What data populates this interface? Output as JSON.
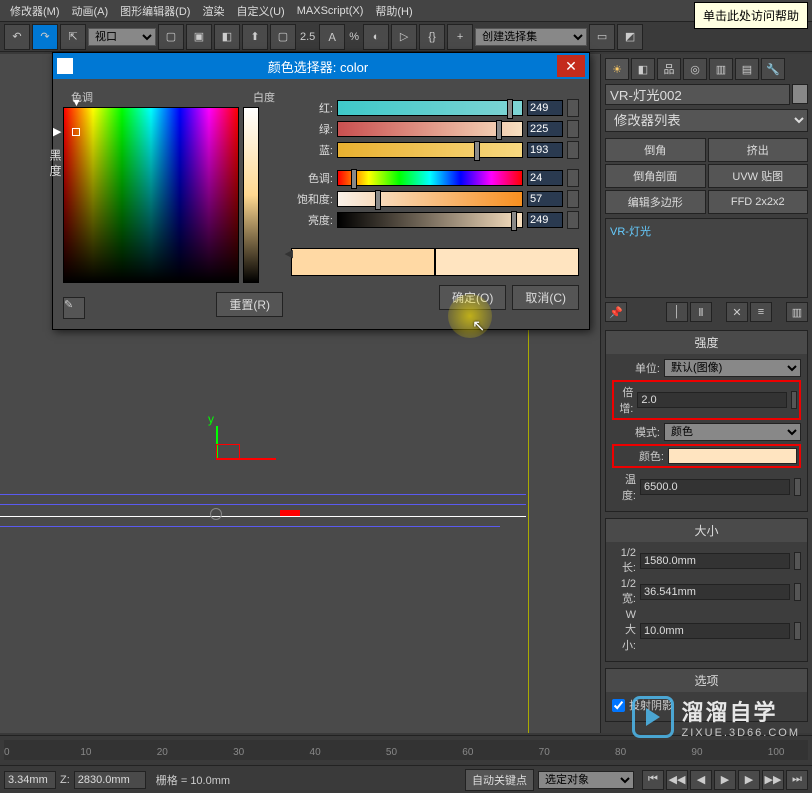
{
  "menubar": {
    "items": [
      "修改器(M)",
      "动画(A)",
      "图形编辑器(D)",
      "渲染",
      "自定义(U)",
      "MAXScript(X)",
      "帮助(H)"
    ]
  },
  "tooltip": "单击此处访问帮助",
  "toolbar": {
    "view_dropdown": "视口",
    "zoom_label": "2.5",
    "percent": "%",
    "selset_dropdown": "创建选择集"
  },
  "dialog": {
    "title": "颜色选择器: color",
    "hue_label": "色调",
    "whiteness_label": "白度",
    "blackness_label": "黑\n度",
    "channels": {
      "red": {
        "label": "红:",
        "value": "249"
      },
      "green": {
        "label": "绿:",
        "value": "225"
      },
      "blue": {
        "label": "蓝:",
        "value": "193"
      },
      "hue": {
        "label": "色调:",
        "value": "24"
      },
      "sat": {
        "label": "饱和度:",
        "value": "57"
      },
      "val": {
        "label": "亮度:",
        "value": "249"
      }
    },
    "swatch_old": "#ffd9a4",
    "swatch_new": "#ffe4c0",
    "reset_btn": "重置(R)",
    "ok_btn": "确定(O)",
    "cancel_btn": "取消(C)"
  },
  "viewport": {
    "axis_y": "y"
  },
  "rightpanel": {
    "object_name": "VR-灯光002",
    "modifier_list": "修改器列表",
    "buttons": {
      "bevel": "倒角",
      "extrude": "挤出",
      "bevel_profile": "倒角剖面",
      "uvw": "UVW 贴图",
      "edit_poly": "编辑多边形",
      "ffd": "FFD 2x2x2"
    },
    "stack_item": "VR-灯光",
    "rollout_intensity": {
      "title": "强度",
      "unit_label": "单位:",
      "unit_value": "默认(图像)",
      "multiplier_label": "倍增:",
      "multiplier_value": "2.0",
      "mode_label": "模式:",
      "mode_value": "颜色",
      "color_label": "颜色:",
      "temp_label": "温度:",
      "temp_value": "6500.0"
    },
    "rollout_size": {
      "title": "大小",
      "half_l_label": "1/2 长:",
      "half_l_value": "1580.0mm",
      "half_w_label": "1/2 宽:",
      "half_w_value": "36.541mm",
      "w_size_label": "W 大小:",
      "w_size_value": "10.0mm"
    },
    "rollout_options": {
      "title": "选项",
      "cast_shadows": "投射阴影"
    }
  },
  "timeline": {
    "marks": [
      "0",
      "10",
      "20",
      "30",
      "40",
      "50",
      "60",
      "70",
      "80",
      "90",
      "100"
    ]
  },
  "statusbar": {
    "xyz_x": "3.34mm",
    "z_label": "Z:",
    "z_value": "2830.0mm",
    "grid_label": "栅格 = 10.0mm",
    "autokey": "自动关键点",
    "sel_dropdown": "选定对象"
  },
  "watermark": {
    "title": "溜溜自学",
    "sub": "ZIXUE.3D66.COM"
  }
}
